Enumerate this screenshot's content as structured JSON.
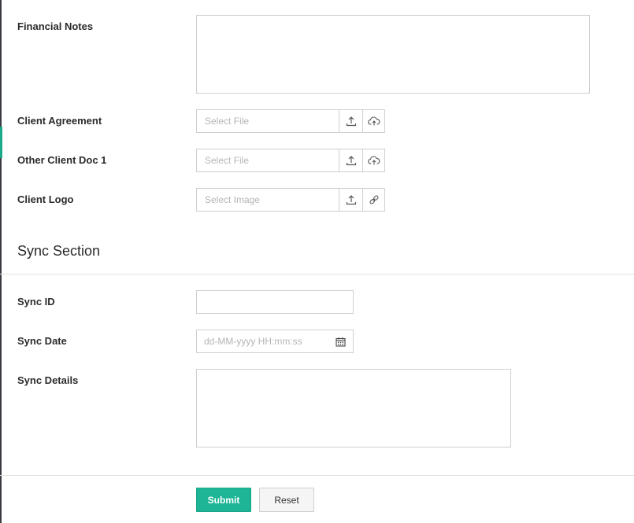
{
  "form": {
    "financial_notes": {
      "label": "Financial Notes",
      "value": ""
    },
    "client_agreement": {
      "label": "Client Agreement",
      "placeholder": "Select File",
      "icons": [
        "upload-icon",
        "cloud-upload-icon"
      ]
    },
    "other_client_doc_1": {
      "label": "Other Client Doc 1",
      "placeholder": "Select File",
      "icons": [
        "upload-icon",
        "cloud-upload-icon"
      ]
    },
    "client_logo": {
      "label": "Client Logo",
      "placeholder": "Select Image",
      "icons": [
        "upload-icon",
        "link-icon"
      ]
    }
  },
  "sync_section": {
    "title": "Sync Section",
    "sync_id": {
      "label": "Sync ID",
      "value": ""
    },
    "sync_date": {
      "label": "Sync Date",
      "placeholder": "dd-MM-yyyy HH:mm:ss",
      "icon": "calendar-icon"
    },
    "sync_details": {
      "label": "Sync Details",
      "value": ""
    }
  },
  "actions": {
    "submit_label": "Submit",
    "reset_label": "Reset"
  },
  "colors": {
    "accent": "#1db596",
    "border": "#cfcfcf",
    "placeholder": "#b5b5b5",
    "sidebar_edge": "#3a3d42"
  }
}
